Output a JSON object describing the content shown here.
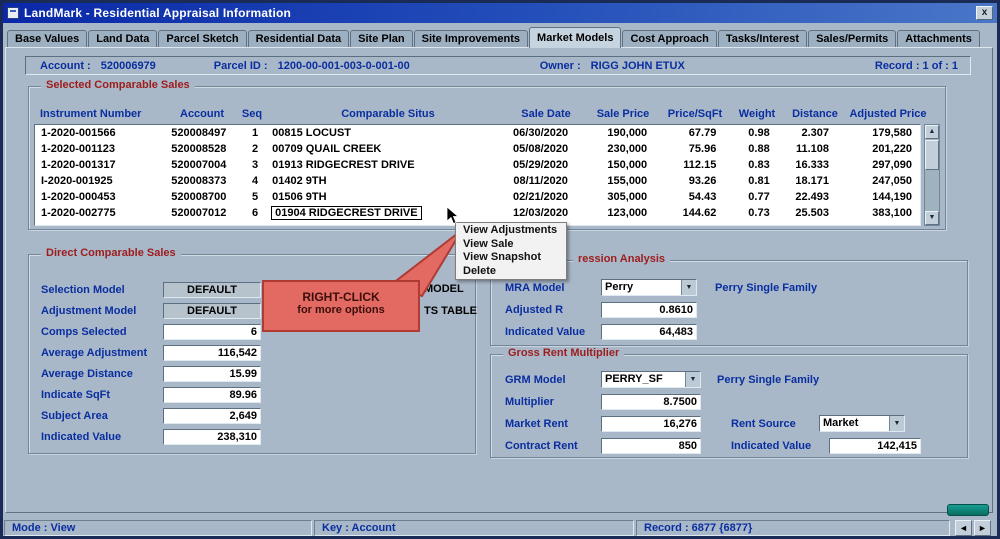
{
  "window": {
    "title": "LandMark - Residential Appraisal Information",
    "close_label": "x"
  },
  "tabs": [
    {
      "label": "Base Values"
    },
    {
      "label": "Land Data"
    },
    {
      "label": "Parcel Sketch"
    },
    {
      "label": "Residential Data"
    },
    {
      "label": "Site Plan"
    },
    {
      "label": "Site Improvements"
    },
    {
      "label": "Market Models"
    },
    {
      "label": "Cost Approach"
    },
    {
      "label": "Tasks/Interest"
    },
    {
      "label": "Sales/Permits"
    },
    {
      "label": "Attachments"
    }
  ],
  "account_bar": {
    "account_label": "Account :",
    "account_value": "520006979",
    "parcel_label": "Parcel ID :",
    "parcel_value": "1200-00-001-003-0-001-00",
    "owner_label": "Owner :",
    "owner_value": "RIGG JOHN ETUX",
    "record_text": "Record : 1 of : 1"
  },
  "comp_sales": {
    "title": "Selected Comparable Sales",
    "columns": [
      "Instrument Number",
      "Account",
      "Seq",
      "Comparable Situs",
      "Sale Date",
      "Sale Price",
      "Price/SqFt",
      "Weight",
      "Distance",
      "Adjusted Price"
    ],
    "rows": [
      [
        "1-2020-001566",
        "520008497",
        "1",
        "00815 LOCUST",
        "06/30/2020",
        "190,000",
        "67.79",
        "0.98",
        "2.307",
        "179,580"
      ],
      [
        "1-2020-001123",
        "520008528",
        "2",
        "00709 QUAIL CREEK",
        "05/08/2020",
        "230,000",
        "75.96",
        "0.88",
        "11.108",
        "201,220"
      ],
      [
        "1-2020-001317",
        "520007004",
        "3",
        "01913 RIDGECREST DRIVE",
        "05/29/2020",
        "150,000",
        "112.15",
        "0.83",
        "16.333",
        "297,090"
      ],
      [
        "I-2020-001925",
        "520008373",
        "4",
        "01402 9TH",
        "08/11/2020",
        "155,000",
        "93.26",
        "0.81",
        "18.171",
        "247,050"
      ],
      [
        "1-2020-000453",
        "520008700",
        "5",
        "01506 9TH",
        "02/21/2020",
        "305,000",
        "54.43",
        "0.77",
        "22.493",
        "144,190"
      ],
      [
        "1-2020-002775",
        "520007012",
        "6",
        "01904 RIDGECREST DRIVE",
        "12/03/2020",
        "123,000",
        "144.62",
        "0.73",
        "25.503",
        "383,100"
      ]
    ]
  },
  "context_menu": {
    "items": [
      "View Adjustments",
      "View Sale",
      "View Snapshot",
      "Delete"
    ]
  },
  "callout": {
    "line1": "RIGHT-CLICK",
    "line2": "for more options"
  },
  "obscured_labels": {
    "model_fragment": "MODEL",
    "table_fragment": "TS TABLE"
  },
  "direct_comp": {
    "title": "Direct Comparable Sales",
    "fields": [
      {
        "label": "Selection Model",
        "value": "DEFAULT"
      },
      {
        "label": "Adjustment Model",
        "value": "DEFAULT"
      },
      {
        "label": "Comps Selected",
        "value": "6"
      },
      {
        "label": "Average Adjustment",
        "value": "116,542"
      },
      {
        "label": "Average Distance",
        "value": "15.99"
      },
      {
        "label": "Indicate SqFt",
        "value": "89.96"
      },
      {
        "label": "Subject Area",
        "value": "2,649"
      },
      {
        "label": "Indicated Value",
        "value": "238,310"
      }
    ]
  },
  "regression": {
    "title_fragment": "ression Analysis",
    "mra_model_label": "MRA Model",
    "mra_model_value": "Perry",
    "mra_model_caption": "Perry Single Family",
    "adjusted_r_label": "Adjusted R",
    "adjusted_r_value": "0.8610",
    "indicated_value_label": "Indicated Value",
    "indicated_value": "64,483"
  },
  "grm": {
    "title": "Gross Rent Multiplier",
    "grm_model_label": "GRM Model",
    "grm_model_value": "PERRY_SF",
    "grm_model_caption": "Perry Single Family",
    "multiplier_label": "Multiplier",
    "multiplier_value": "8.7500",
    "market_rent_label": "Market Rent",
    "market_rent_value": "16,276",
    "rent_source_label": "Rent Source",
    "rent_source_value": "Market",
    "contract_rent_label": "Contract Rent",
    "contract_rent_value": "850",
    "indicated_value_label": "Indicated Value",
    "indicated_value": "142,415"
  },
  "status_bar": {
    "mode": "Mode : View",
    "key": "Key : Account",
    "record": "Record : 6877 {6877}",
    "nav_left": "◄",
    "nav_right": "►",
    "scroll_up": "▲",
    "scroll_down": "▼",
    "dropdown_arrow": "▼"
  }
}
